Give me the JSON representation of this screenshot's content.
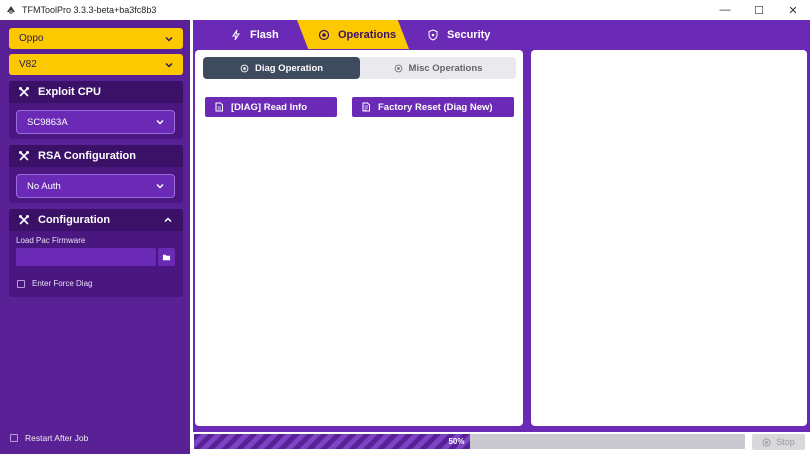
{
  "window": {
    "title": "TFMToolPro 3.3.3-beta+ba3fc8b3",
    "minimize_glyph": "—",
    "maximize_glyph": "☐",
    "close_glyph": "✕"
  },
  "sidebar": {
    "brand": "Oppo",
    "model": "V82",
    "exploit_cpu": {
      "title": "Exploit CPU",
      "value": "SC9863A"
    },
    "rsa_configuration": {
      "title": "RSA Configuration",
      "value": "No Auth"
    },
    "configuration": {
      "title": "Configuration",
      "load_pac_label": "Load Pac Firmware",
      "load_pac_value": "",
      "enter_force_diag": "Enter Force Diag"
    },
    "restart_after_job": "Restart After Job"
  },
  "nav": {
    "tabs": [
      {
        "label": "Flash",
        "icon": "lightning-icon"
      },
      {
        "label": "Operations",
        "icon": "gear-icon",
        "active": true
      },
      {
        "label": "Security",
        "icon": "shield-icon"
      }
    ]
  },
  "operations": {
    "subtabs": [
      {
        "label": "Diag Operation",
        "active": true
      },
      {
        "label": "Misc Operations"
      }
    ],
    "buttons": [
      {
        "label": "[DIAG] Read Info",
        "icon": "document-icon"
      },
      {
        "label": "Factory Reset (Diag New)",
        "icon": "file-reset-icon"
      }
    ]
  },
  "progress": {
    "value": 0.5,
    "label": "50%"
  },
  "stop_label": "Stop",
  "colors": {
    "purple_dark": "#5a2196",
    "purple": "#6a2ab5",
    "yellow": "#fcc800",
    "subtab_active": "#3e4a5e"
  }
}
